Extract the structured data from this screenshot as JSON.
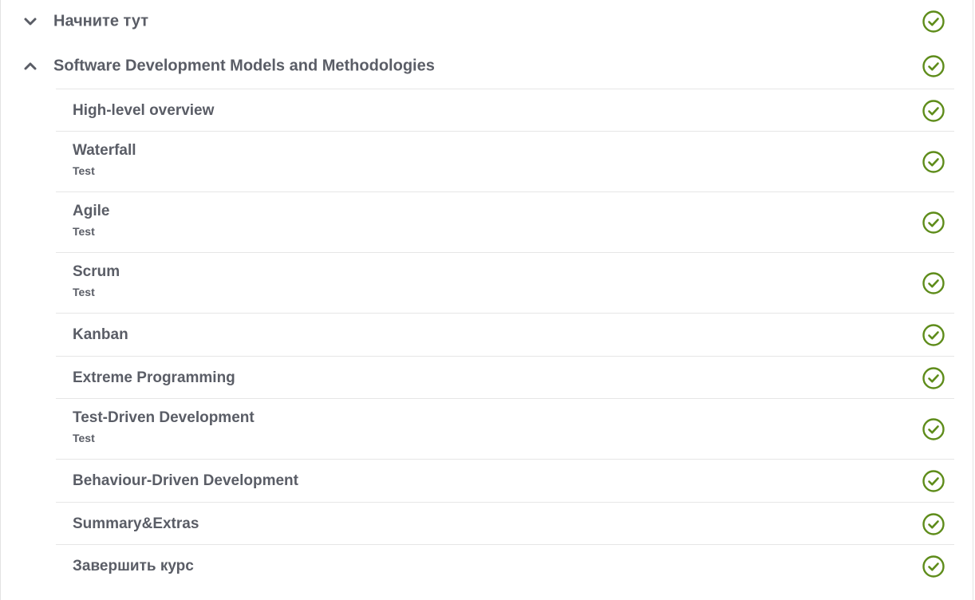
{
  "colors": {
    "text": "#5a5d66",
    "check": "#5e8c1a",
    "divider": "#e6e6e6"
  },
  "sections": [
    {
      "title": "Начните тут",
      "expanded": false,
      "chevron_icon": "chevron-down-icon",
      "status_icon": "check-circle-icon"
    },
    {
      "title": "Software Development Models and Methodologies",
      "expanded": true,
      "chevron_icon": "chevron-up-icon",
      "status_icon": "check-circle-icon",
      "lessons": [
        {
          "title": "High-level overview",
          "subtitle": ""
        },
        {
          "title": "Waterfall",
          "subtitle": "Test"
        },
        {
          "title": "Agile",
          "subtitle": "Test"
        },
        {
          "title": "Scrum",
          "subtitle": "Test"
        },
        {
          "title": "Kanban",
          "subtitle": ""
        },
        {
          "title": "Extreme Programming",
          "subtitle": ""
        },
        {
          "title": "Test-Driven Development",
          "subtitle": "Test"
        },
        {
          "title": "Behaviour-Driven Development",
          "subtitle": ""
        },
        {
          "title": "Summary&Extras",
          "subtitle": ""
        },
        {
          "title": "Завершить курс",
          "subtitle": ""
        }
      ]
    }
  ]
}
